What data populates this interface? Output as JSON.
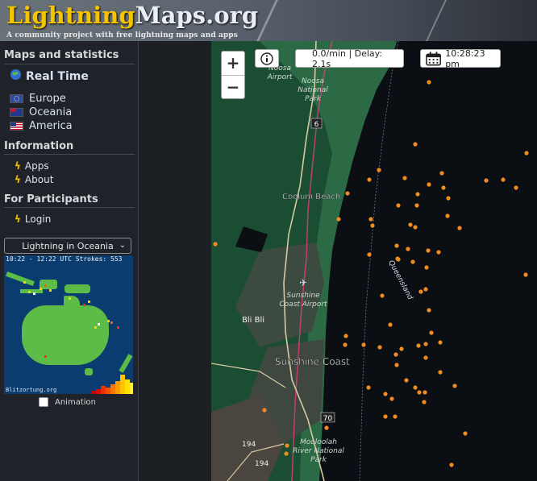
{
  "header": {
    "logo_part1": "Lightning",
    "logo_part2": "Maps.org",
    "tagline": "A community project with free lightning maps and apps"
  },
  "sidebar": {
    "maps_title": "Maps and statistics",
    "realtime_label": "Real Time",
    "regions": [
      {
        "label": "Europe",
        "flag": "eu-flag-icon"
      },
      {
        "label": "Oceania",
        "flag": "au-flag-icon"
      },
      {
        "label": "America",
        "flag": "us-flag-icon"
      }
    ],
    "info_title": "Information",
    "info_items": [
      "Apps",
      "About"
    ],
    "participants_title": "For Participants",
    "login_label": "Login",
    "region_select_value": "Lightning in Oceania",
    "minimap": {
      "header_text": "10:22 - 12:22 UTC  Strokes: 553",
      "footer_text": "Blitzortung.org"
    },
    "animation_label": "Animation"
  },
  "map": {
    "zoom_in": "+",
    "zoom_out": "−",
    "status_text": "0.0/min | Delay: 2.1s",
    "time_text": "10:28:23 pm",
    "labels": {
      "noosa_airport": [
        "Noosa",
        "Airport"
      ],
      "noosa_park": [
        "Noosa",
        "National",
        "Park"
      ],
      "route6": "6",
      "coolum": "Coolum Beach",
      "queensland": "Queensland",
      "sunshine_airport": [
        "Sunshine",
        "Coast Airport"
      ],
      "bli_bli": "Bli Bli",
      "sunshine_coast": "Sunshine Coast",
      "route70": "70",
      "route194a": "194",
      "route194b": "194",
      "mooloolah": [
        "Mooloolah",
        "River National",
        "Park"
      ]
    },
    "colors": {
      "water": "#0b0e12",
      "forest": "#1f5a3a",
      "strike": "#f28c1e",
      "road": "#d6c9a2",
      "coast_route": "#e63c7a"
    }
  }
}
